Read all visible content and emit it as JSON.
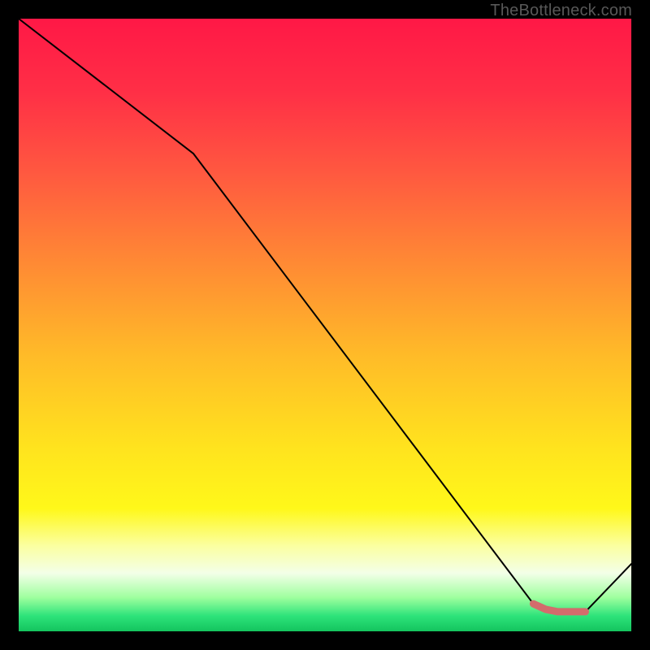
{
  "attribution": "TheBottleneck.com",
  "chart_data": {
    "type": "line",
    "title": "",
    "xlabel": "",
    "ylabel": "",
    "xlim": [
      0,
      100
    ],
    "ylim": [
      0,
      100
    ],
    "x": [
      0,
      28.5,
      84,
      88,
      92.5,
      100
    ],
    "values": [
      100,
      78,
      4.5,
      3.2,
      3.2,
      11
    ],
    "highlight": {
      "color": "#d36c6c",
      "x": [
        84,
        86,
        88,
        90,
        92.5
      ],
      "values": [
        4.5,
        3.6,
        3.2,
        3.2,
        3.2
      ]
    },
    "background_gradient": {
      "stops": [
        {
          "pos": 0.0,
          "color": "#ff1846"
        },
        {
          "pos": 0.12,
          "color": "#ff2f46"
        },
        {
          "pos": 0.25,
          "color": "#ff5840"
        },
        {
          "pos": 0.4,
          "color": "#ff8a34"
        },
        {
          "pos": 0.55,
          "color": "#ffbb28"
        },
        {
          "pos": 0.7,
          "color": "#ffe31e"
        },
        {
          "pos": 0.8,
          "color": "#fff81a"
        },
        {
          "pos": 0.86,
          "color": "#fbffa0"
        },
        {
          "pos": 0.905,
          "color": "#f3ffe8"
        },
        {
          "pos": 0.945,
          "color": "#9eff9e"
        },
        {
          "pos": 0.975,
          "color": "#2de37a"
        },
        {
          "pos": 1.0,
          "color": "#14c45e"
        }
      ]
    }
  }
}
